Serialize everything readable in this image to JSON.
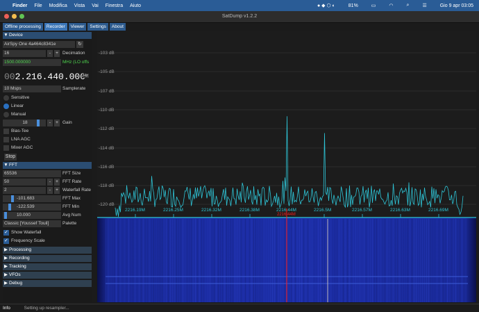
{
  "menubar": {
    "app": "Finder",
    "items": [
      "File",
      "Modifica",
      "Vista",
      "Vai",
      "Finestra",
      "Aiuto"
    ],
    "battery": "81%",
    "datetime": "Gio 9 apr  03:05"
  },
  "window": {
    "title": "SatDump v1.2.2",
    "tabs": [
      "Offline processing",
      "Recorder",
      "Viewer",
      "Settings",
      "About"
    ]
  },
  "device": {
    "header": "Device",
    "device_name": "AirSpy One 4a464c8341e",
    "decimation_value": "16",
    "decimation_label": "Decimation",
    "lo_value": "1500.000000",
    "lo_label": "MHz (LO offs",
    "frequency_dim": "00",
    "frequency_main": "2.216.440.000",
    "freq_unit": "Hz",
    "samplerate_value": "10 Msps",
    "samplerate_label": "Samplerate",
    "gain_modes": [
      "Sensitive",
      "Linear",
      "Manual"
    ],
    "gain_mode_selected": "Linear",
    "gain_value": "18",
    "gain_label": "Gain",
    "gain_level": 0.85,
    "bias_tee": "Bias-Tee",
    "lna_agc": "LNA AGC",
    "mixer_agc": "Mixer AGC",
    "stop": "Stop"
  },
  "fft": {
    "header": "FFT",
    "size_value": "65536",
    "size_label": "FFT Size",
    "rate_value": "50",
    "rate_label": "FFT Rate",
    "wf_rate_value": "2",
    "wf_rate_label": "Waterfall Rate",
    "max_value": "-101.683",
    "max_label": "FFT Max",
    "min_value": "-122.539",
    "min_label": "FFT Min",
    "avg_value": "10.000",
    "avg_label": "Avg Num",
    "palette_value": "Classic [Youssef Touil]",
    "palette_label": "Palette",
    "show_waterfall": "Show Waterfall",
    "freq_scale": "Frequency Scale"
  },
  "sections": [
    "Processing",
    "Recording",
    "Tracking",
    "VFOs",
    "Debug"
  ],
  "status": {
    "tag": "Info",
    "message": "Setting up resampler..."
  },
  "colors": {
    "accent": "#2a5c96",
    "trace": "#2ec4d6",
    "marker_red": "#ff2020"
  },
  "chart_data": {
    "type": "line",
    "y_ticks": [
      "-103 dB",
      "-105 dB",
      "-107 dB",
      "-110 dB",
      "-112 dB",
      "-114 dB",
      "-116 dB",
      "-118 dB",
      "-120 dB"
    ],
    "x_ticks": [
      "2216.19M",
      "2216.25M",
      "2216.32M",
      "2216.38M",
      "2216.44M",
      "2216.5M",
      "2216.57M",
      "2216.63M",
      "2216.69M"
    ],
    "selected_freq_label": "2216.44M",
    "ylim": [
      -121,
      -102
    ],
    "peaks": [
      {
        "x": "2216.44M",
        "y": -109.5
      },
      {
        "x": "2216.5M",
        "y": -111.5
      }
    ]
  }
}
